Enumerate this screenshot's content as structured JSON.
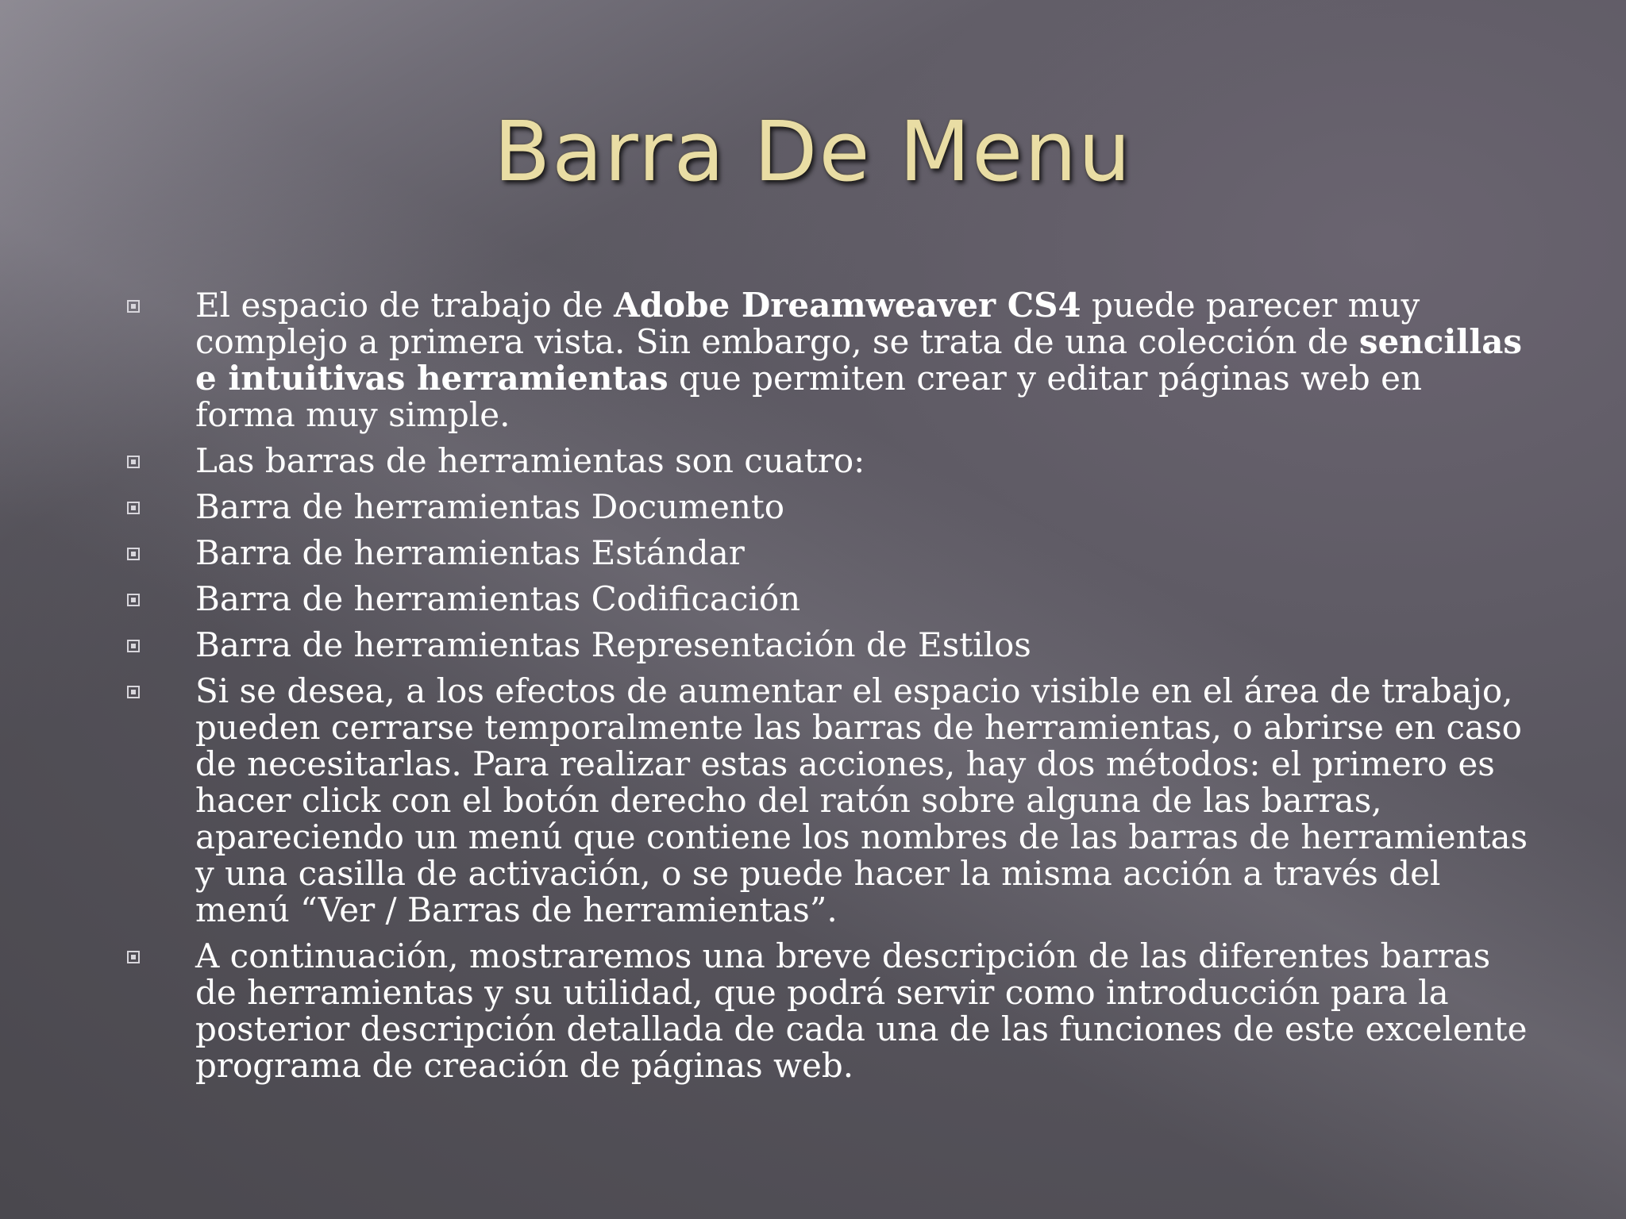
{
  "title": "Barra De Menu",
  "bullets": [
    {
      "p1": "El espacio de trabajo de ",
      "b1": "Adobe Dreamweaver CS4",
      "p2": " puede parecer muy complejo a primera vista. Sin embargo, se trata de una colección de ",
      "b2": "sencillas e intuitivas herramientas",
      "p3": " que permiten crear y editar páginas web en forma muy simple."
    },
    {
      "text": "Las barras de herramientas son cuatro:"
    },
    {
      "text": "Barra de herramientas Documento"
    },
    {
      "text": "Barra de herramientas Estándar"
    },
    {
      "text": "Barra de herramientas Codificación"
    },
    {
      "text": "Barra de herramientas Representación de Estilos"
    },
    {
      "text": "Si se desea, a los efectos de aumentar el espacio visible en el área de trabajo, pueden cerrarse temporalmente las barras de herramientas, o abrirse en caso de necesitarlas. Para realizar estas acciones, hay dos métodos: el primero es hacer click con el botón derecho del ratón sobre alguna de las barras, apareciendo un menú que contiene los nombres de las barras de herramientas y una casilla de activación, o se puede hacer la misma acción a través del menú “Ver / Barras de herramientas”."
    },
    {
      "text": "A continuación, mostraremos una breve descripción de las diferentes barras de herramientas y su utilidad, que podrá servir como introducción para la posterior descripción detallada de cada una de las funciones de este excelente programa de creación de páginas web."
    }
  ]
}
